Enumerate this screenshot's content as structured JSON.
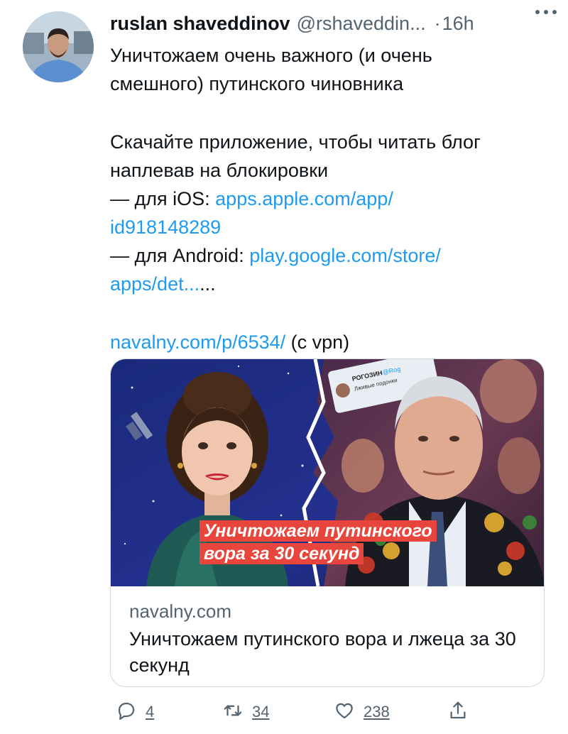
{
  "tweet": {
    "author_name": "ruslan shaveddinov",
    "author_handle": "@rshaveddin...",
    "separator": "·",
    "time": "16h",
    "text": {
      "line1": "Уничтожаем очень важного (и очень",
      "line2": "смешного) путинского чиновника",
      "line3": "Скачайте приложение, чтобы читать блог",
      "line4": "наплевав на блокировки",
      "ios_prefix": "— для iOS: ",
      "ios_link_part1": "apps.apple.com/app/",
      "ios_link_part2": "id918148289",
      "android_prefix": "— для Android: ",
      "android_link_part1": "play.google.com/store/",
      "android_link_part2": "apps/det...",
      "android_suffix": "...",
      "site_link": "navalny.com/p/6534/",
      "site_suffix": " (с vpn)"
    }
  },
  "card": {
    "banner_line1": "Уничтожаем путинского",
    "banner_line2": "вора за 30 секунд",
    "inset_name": "РОГОЗИН",
    "inset_handle": "@Rog",
    "inset_text": "Лживые подонки",
    "domain": "navalny.com",
    "title": "Уничтожаем путинского вора и лжеца за 30 секунд"
  },
  "actions": {
    "reply_count": "4",
    "retweet_count": "34",
    "like_count": "238"
  },
  "icons": {
    "more": "more-icon",
    "reply": "reply-icon",
    "retweet": "retweet-icon",
    "like": "like-icon",
    "share": "share-icon"
  },
  "colors": {
    "link": "#1d9bf0",
    "secondary_text": "#536471",
    "banner": "#e8453c"
  }
}
